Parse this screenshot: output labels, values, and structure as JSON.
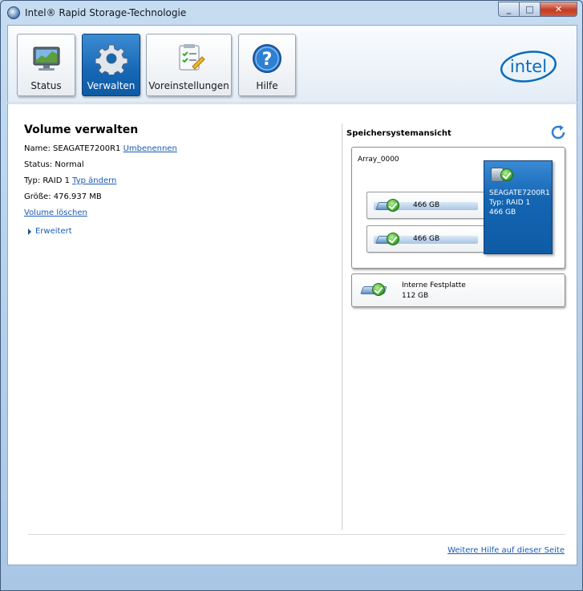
{
  "window": {
    "title": "Intel® Rapid Storage-Technologie",
    "min": "_",
    "max": "□",
    "close": "✕"
  },
  "toolbar": {
    "buttons": [
      {
        "label": "Status",
        "icon": "monitor-icon"
      },
      {
        "label": "Verwalten",
        "icon": "gear-icon",
        "active": true
      },
      {
        "label": "Voreinstellungen",
        "icon": "checklist-icon"
      },
      {
        "label": "Hilfe",
        "icon": "help-icon"
      }
    ],
    "logo_text": "intel"
  },
  "manage": {
    "title": "Volume verwalten",
    "name_prefix": "Name: SEAGATE7200R1",
    "rename_link": "Umbenennen",
    "status": "Status: Normal",
    "type_prefix": "Typ: RAID 1",
    "change_type_link": "Typ ändern",
    "size": "Größe: 476.937 MB",
    "delete_link": "Volume löschen",
    "advanced": "Erweitert"
  },
  "storage_view": {
    "title": "Speichersystemansicht",
    "array_label": "Array_0000",
    "disks": [
      {
        "capacity": "466 GB"
      },
      {
        "capacity": "466 GB"
      }
    ],
    "volume": {
      "name": "SEAGATE7200R1",
      "type": "Typ: RAID 1",
      "size": "466 GB"
    },
    "internal_disk": {
      "label": "Interne Festplatte",
      "capacity": "112 GB"
    }
  },
  "footer": {
    "help_link": "Weitere Hilfe auf dieser Seite"
  },
  "colors": {
    "accent": "#1466b3",
    "link": "#1a5bb5",
    "ok": "#3ba62a"
  }
}
